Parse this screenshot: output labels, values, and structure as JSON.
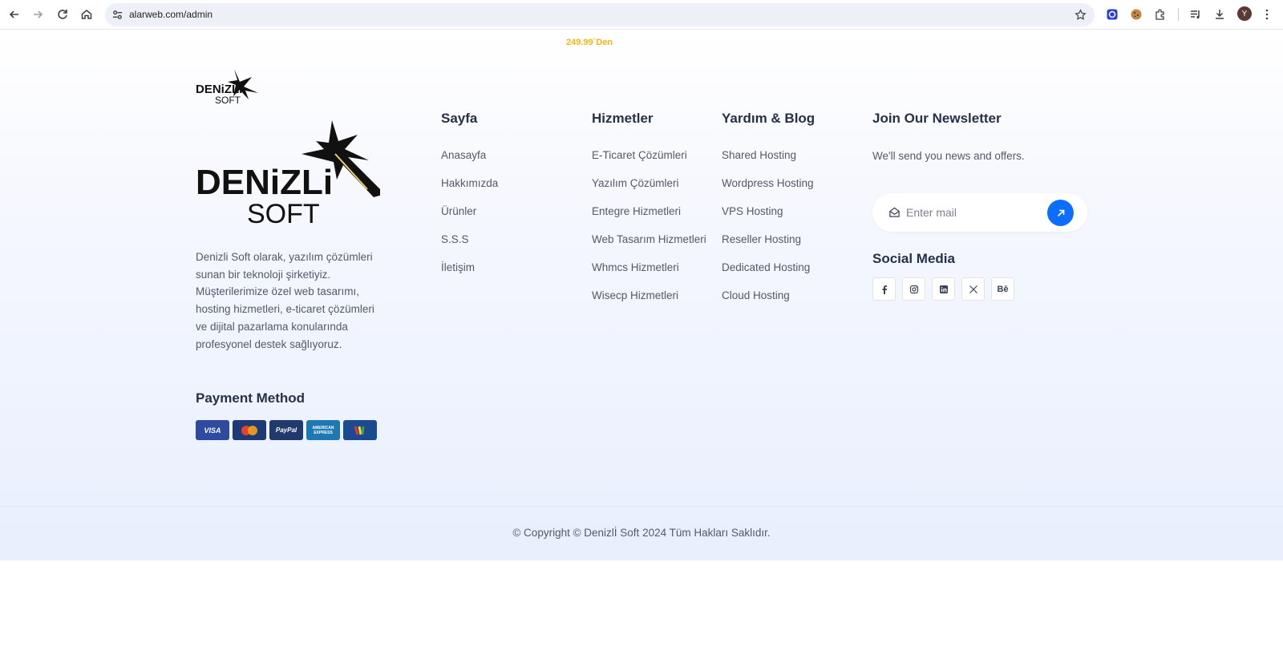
{
  "browser": {
    "url": "alarweb.com/admin",
    "avatar_letter": "Y"
  },
  "promo": {
    "price": "249.99`Den"
  },
  "brand": {
    "logo_line1": "DENiZLi",
    "logo_line2": "SOFT",
    "about": "Denizli Soft olarak, yazılım çözümleri sunan bir teknoloji şirketiyiz. Müşterilerimize özel web tasarımı, hosting hizmetleri, e-ticaret çözümleri ve dijital pazarlama konularında profesyonel destek sağlıyoruz."
  },
  "payment": {
    "title": "Payment Method",
    "cards": [
      {
        "label": "VISA",
        "color": "#2f4b9f"
      },
      {
        "label": "MasterCard",
        "color": "#1e3a74"
      },
      {
        "label": "PayPal",
        "color": "#203a6e"
      },
      {
        "label": "AMERICAN EXPRESS",
        "color": "#1d78b4"
      },
      {
        "label": "Other",
        "color": "#1c4a8f"
      }
    ]
  },
  "columns": {
    "sayfa": {
      "title": "Sayfa",
      "items": [
        "Anasayfa",
        "Hakkımızda",
        "Ürünler",
        "S.S.S",
        "İletişim"
      ]
    },
    "hizmetler": {
      "title": "Hizmetler",
      "items": [
        "E-Ticaret Çözümleri",
        "Yazılım Çözümleri",
        "Entegre Hizmetleri",
        "Web Tasarım Hizmetleri",
        "Whmcs Hizmetleri",
        "Wisecp Hizmetleri"
      ]
    },
    "yardim": {
      "title": "Yardım & Blog",
      "items": [
        "Shared Hosting",
        "Wordpress Hosting",
        "VPS Hosting",
        "Reseller Hosting",
        "Dedicated Hosting",
        "Cloud Hosting"
      ]
    }
  },
  "newsletter": {
    "title": "Join Our Newsletter",
    "text": "We'll send you news and offers.",
    "placeholder": "Enter mail"
  },
  "social": {
    "title": "Social Media",
    "items": [
      "facebook-icon",
      "instagram-icon",
      "linkedin-icon",
      "x-icon",
      "behance-icon"
    ],
    "behance_label": "Bē"
  },
  "footer": {
    "copyright": "© Copyright © Denizlİ Soft 2024 Tüm Hakları Saklıdır."
  },
  "colors": {
    "accent": "#0d6efd",
    "promo": "#f3b714",
    "heading": "#27304a"
  }
}
